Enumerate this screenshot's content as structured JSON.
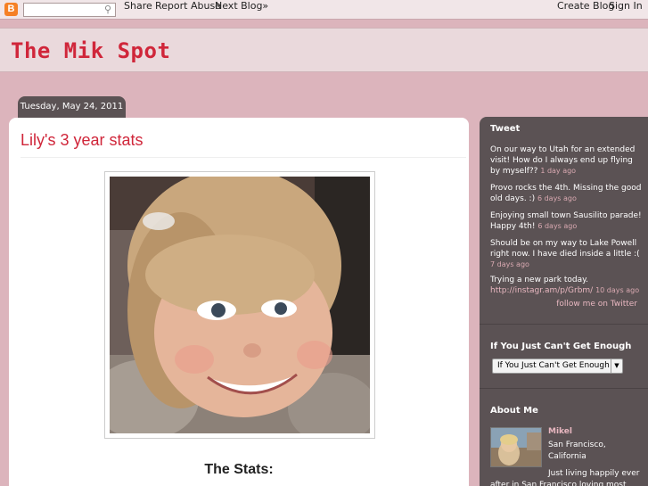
{
  "navbar": {
    "share_label": "Share",
    "report_label": "Report Abuse",
    "next_label": "Next Blog»",
    "create_label": "Create Blog",
    "signin_label": "Sign In",
    "logo_letter": "B"
  },
  "blog": {
    "title": "The Mik Spot"
  },
  "post": {
    "date": "Tuesday, May 24, 2011",
    "title": "Lily's 3 year stats",
    "stats_heading": "The Stats:"
  },
  "sidebar": {
    "tweet_title": "Tweet",
    "tweets": [
      {
        "text": "On our way to Utah for an extended visit! How do I always end up flying by myself?? ",
        "ago": "1 day ago"
      },
      {
        "text": "Provo rocks the 4th. Missing the good old days. :) ",
        "ago": "6 days ago"
      },
      {
        "text": "Enjoying small town Sausilito parade! Happy 4th! ",
        "ago": "6 days ago"
      },
      {
        "text": "Should be on my way to Lake Powell right now. I have died inside a little :( ",
        "ago": "7 days ago"
      },
      {
        "text": "Trying a new park today. ",
        "link": "http://instagr.am/p/Grbm/",
        "ago": "10 days ago"
      }
    ],
    "follow_label": "follow me on Twitter",
    "more_title": "If You Just Can't Get Enough",
    "select_value": "If You Just Can't Get Enough",
    "about_title": "About Me",
    "about_name": "Mikel",
    "about_location": "San Francisco, California",
    "about_description": "Just living happily ever after in San Francisco loving most"
  }
}
